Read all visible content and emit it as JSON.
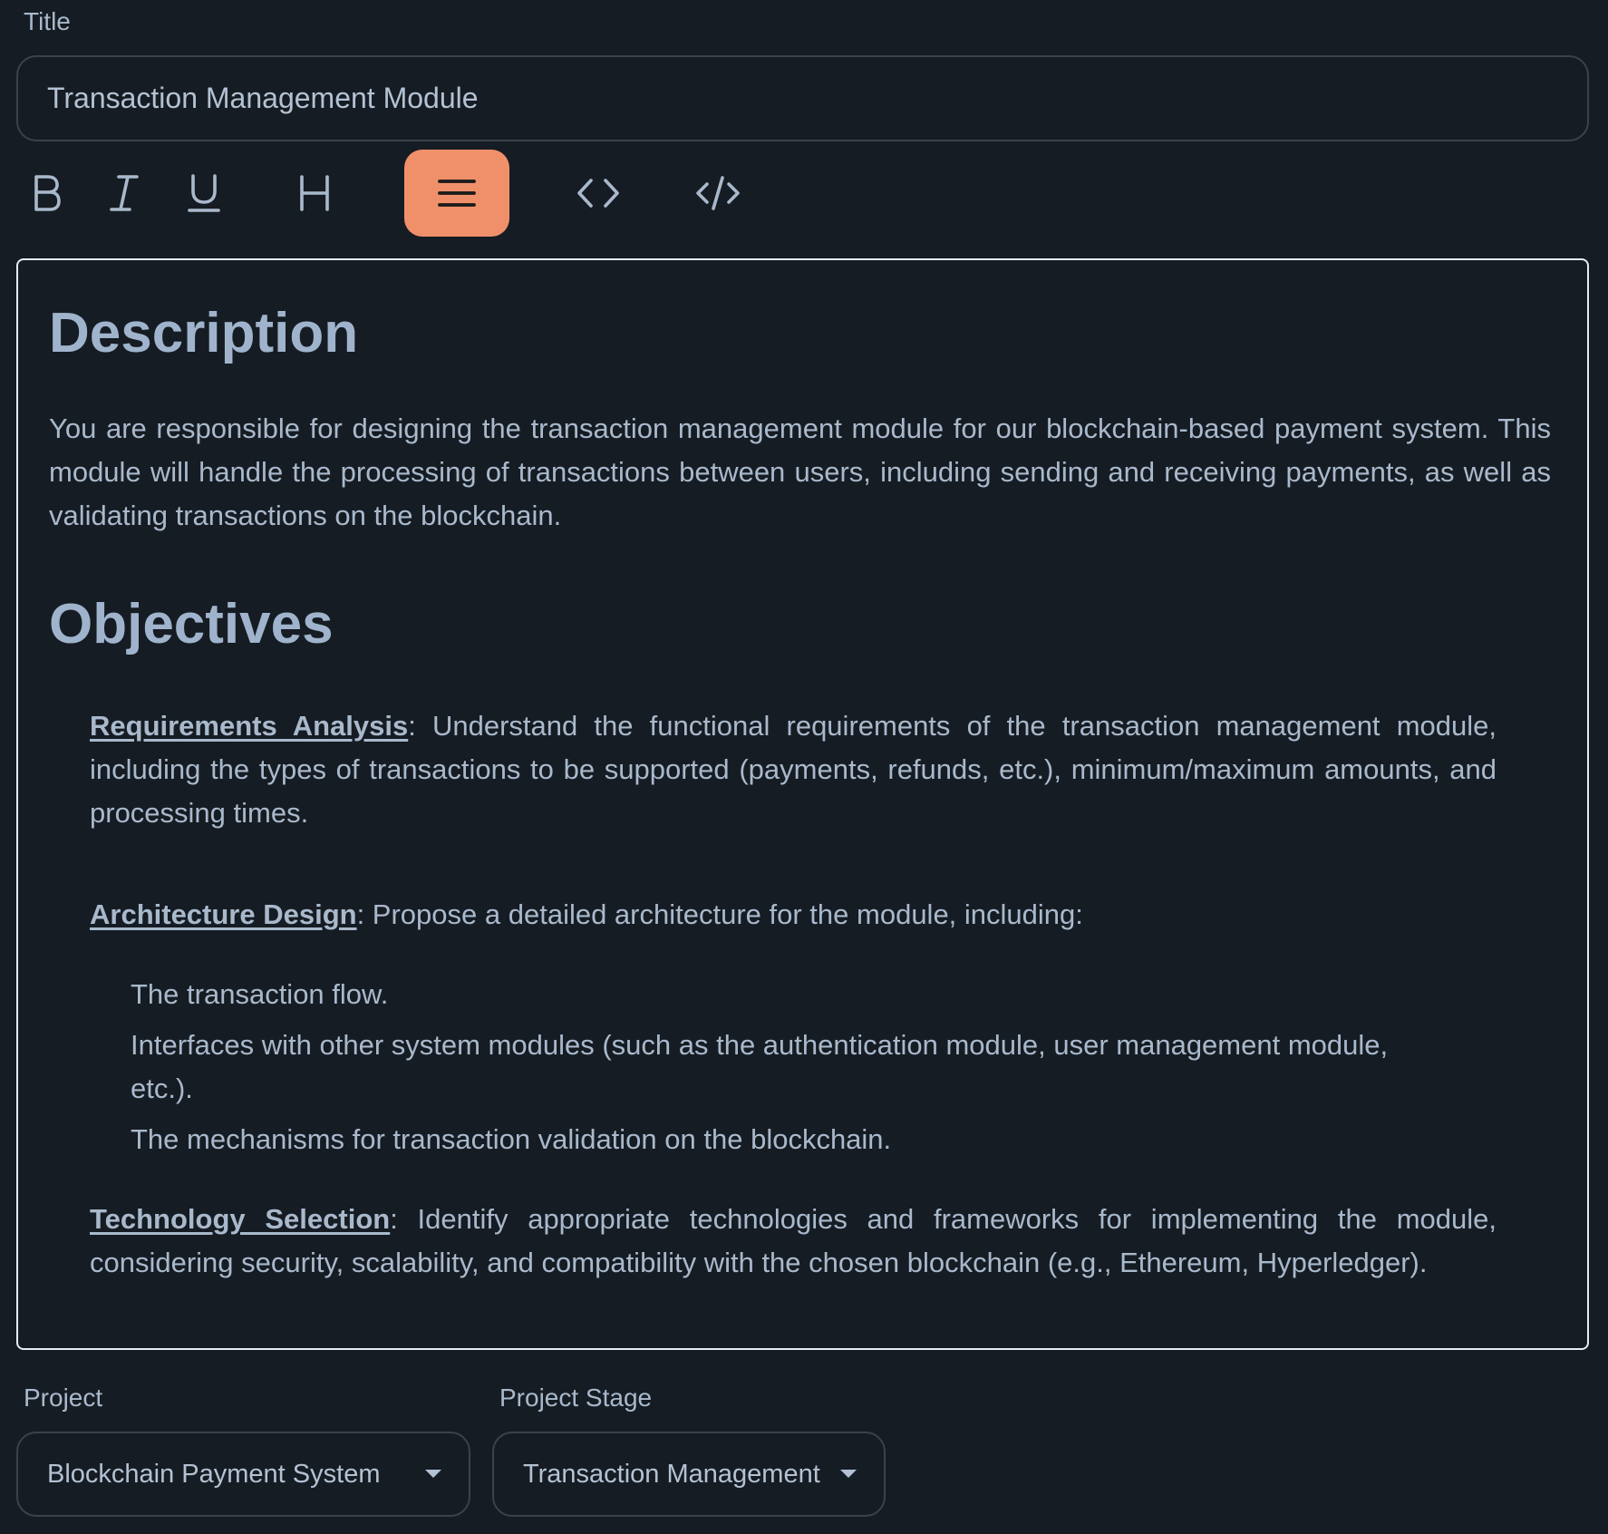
{
  "title_field": {
    "label": "Title",
    "value": "Transaction Management Module"
  },
  "toolbar": {
    "buttons": [
      {
        "name": "bold",
        "icon": "bold-icon"
      },
      {
        "name": "italic",
        "icon": "italic-icon"
      },
      {
        "name": "underline",
        "icon": "underline-icon"
      },
      {
        "name": "heading",
        "icon": "heading-icon"
      },
      {
        "name": "list",
        "icon": "list-icon",
        "active": true
      },
      {
        "name": "code",
        "icon": "code-icon"
      },
      {
        "name": "code-block",
        "icon": "code-block-icon"
      }
    ],
    "active_color": "#f0906a"
  },
  "editor": {
    "description_heading": "Description",
    "description_text": "You are responsible for designing the transaction management module for our blockchain-based payment system. This module will handle the processing of transactions between users, including sending and receiving payments, as well as validating transactions on the blockchain.",
    "objectives_heading": "Objectives",
    "objectives": [
      {
        "key": "Requirements Analysis",
        "text": ": Understand the functional requirements of the transaction management module, including the types of transactions to be supported (payments, refunds, etc.), minimum/maximum amounts, and processing times."
      },
      {
        "key": "Architecture Design",
        "text": ": Propose a detailed architecture for the module, including:",
        "subitems": [
          "The transaction flow.",
          "Interfaces with other system modules (such as the authentication module, user management module, etc.).",
          "The mechanisms for transaction validation on the blockchain."
        ]
      },
      {
        "key": "Technology Selection",
        "text": ": Identify appropriate technologies and frameworks for implementing the module, considering security, scalability, and compatibility with the chosen blockchain (e.g., Ethereum, Hyperledger)."
      }
    ]
  },
  "project": {
    "label": "Project",
    "value": "Blockchain Payment System"
  },
  "project_stage": {
    "label": "Project Stage",
    "value": "Transaction Management"
  }
}
